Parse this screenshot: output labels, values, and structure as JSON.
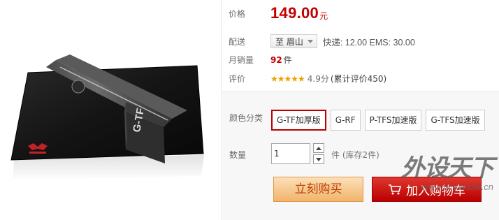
{
  "product": {
    "price_label": "价格",
    "price_value": "149.00",
    "price_unit": "元",
    "shipping_label": "配送",
    "shipping_region": "至 眉山",
    "shipping_fees": "快递: 12.00 EMS: 30.00",
    "sales_label": "月销量",
    "sales_count": "92",
    "sales_unit": "件",
    "rating_label": "评价",
    "rating_stars": "★★★★★",
    "rating_score": "4.9分",
    "rating_count": "(累计评价450)"
  },
  "options": {
    "color_label": "颜色分类",
    "colors": [
      "G-TF加厚版",
      "G-RF",
      "P-TFS加速版",
      "G-TFS加速版"
    ],
    "selected_color": "G-TF加厚版",
    "quantity_label": "数量",
    "quantity_value": "1",
    "stock_text": "件 (库存2件)"
  },
  "actions": {
    "buy_now": "立刻购买",
    "add_to_cart": "加入购物车"
  },
  "watermark": {
    "title": "外设天下",
    "url": "www.pcwaishe.cn"
  },
  "colors": {
    "price_red": "#c40000",
    "selected_border": "#b80000",
    "buy_bg": "#f1b46b",
    "cart_bg": "#c40000"
  }
}
